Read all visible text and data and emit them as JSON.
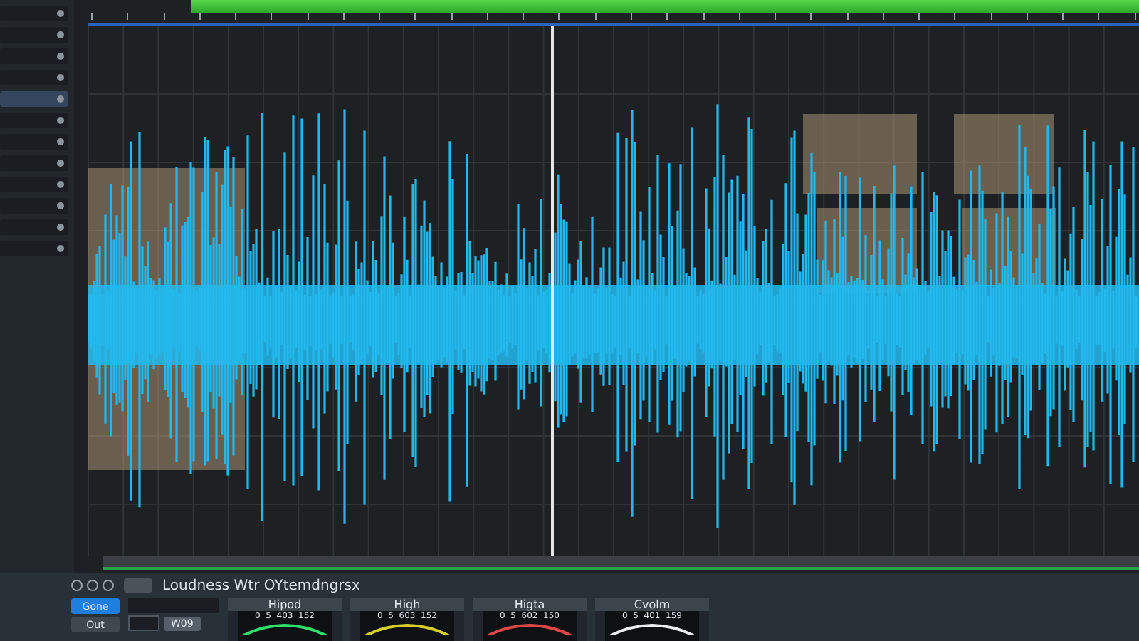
{
  "sidebar": {
    "items": [
      {
        "selected": false
      },
      {
        "selected": false
      },
      {
        "selected": false
      },
      {
        "selected": false
      },
      {
        "selected": true
      },
      {
        "selected": false
      },
      {
        "selected": false
      },
      {
        "selected": false
      },
      {
        "selected": false
      },
      {
        "selected": false
      },
      {
        "selected": false
      },
      {
        "selected": false
      }
    ]
  },
  "timeline": {
    "playhead": {
      "level": 0.44
    }
  },
  "panel": {
    "title": "Loudness Wtr OYtemdngrsx",
    "buttons": [
      {
        "label": "Gone",
        "selected": true
      },
      {
        "label": "Out",
        "selected": false
      }
    ],
    "action": "W09",
    "meters": [
      {
        "title": "Hipod",
        "scale": "0  5  403  152",
        "color": "#2ee06a"
      },
      {
        "title": "High",
        "scale": "0  5  603  152",
        "color": "#d8d02a"
      },
      {
        "title": "Higta",
        "scale": "0  5  602  150",
        "color": "#e04848"
      },
      {
        "title": "Cvolm",
        "scale": "0  5  401  159",
        "color": "#e8eef2"
      }
    ]
  }
}
